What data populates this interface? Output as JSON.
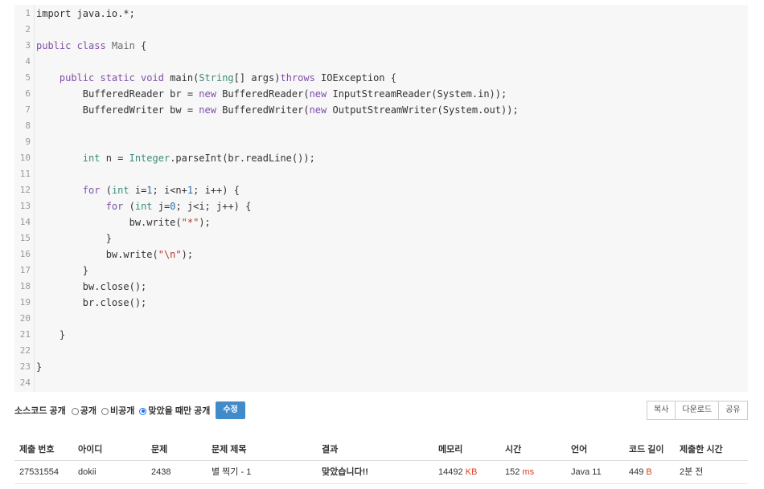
{
  "code": {
    "line_numbers": [
      "1",
      "2",
      "3",
      "4",
      "5",
      "6",
      "7",
      "8",
      "9",
      "10",
      "11",
      "12",
      "13",
      "14",
      "15",
      "16",
      "17",
      "18",
      "19",
      "20",
      "21",
      "22",
      "23",
      "24"
    ],
    "lines": [
      [
        {
          "t": "import java.io.*;",
          "c": ""
        }
      ],
      [],
      [
        {
          "t": "public class ",
          "c": "kw"
        },
        {
          "t": "Main",
          "c": "cn"
        },
        {
          "t": " {",
          "c": ""
        }
      ],
      [],
      [
        {
          "t": "    ",
          "c": ""
        },
        {
          "t": "public static void ",
          "c": "kw"
        },
        {
          "t": "main(",
          "c": ""
        },
        {
          "t": "String",
          "c": "ty"
        },
        {
          "t": "[] args)",
          "c": ""
        },
        {
          "t": "throws ",
          "c": "kw"
        },
        {
          "t": "IOException {",
          "c": ""
        }
      ],
      [
        {
          "t": "        BufferedReader br = ",
          "c": ""
        },
        {
          "t": "new ",
          "c": "kw"
        },
        {
          "t": "BufferedReader(",
          "c": ""
        },
        {
          "t": "new ",
          "c": "kw"
        },
        {
          "t": "InputStreamReader(System.in));",
          "c": ""
        }
      ],
      [
        {
          "t": "        BufferedWriter bw = ",
          "c": ""
        },
        {
          "t": "new ",
          "c": "kw"
        },
        {
          "t": "BufferedWriter(",
          "c": ""
        },
        {
          "t": "new ",
          "c": "kw"
        },
        {
          "t": "OutputStreamWriter(System.out));",
          "c": ""
        }
      ],
      [],
      [],
      [
        {
          "t": "        ",
          "c": ""
        },
        {
          "t": "int ",
          "c": "ty"
        },
        {
          "t": "n = ",
          "c": ""
        },
        {
          "t": "Integer",
          "c": "ty"
        },
        {
          "t": ".parseInt(br.readLine());",
          "c": ""
        }
      ],
      [],
      [
        {
          "t": "        ",
          "c": ""
        },
        {
          "t": "for ",
          "c": "kw"
        },
        {
          "t": "(",
          "c": ""
        },
        {
          "t": "int ",
          "c": "ty"
        },
        {
          "t": "i=",
          "c": ""
        },
        {
          "t": "1",
          "c": "nu"
        },
        {
          "t": "; i<n+",
          "c": ""
        },
        {
          "t": "1",
          "c": "nu"
        },
        {
          "t": "; i++) {",
          "c": ""
        }
      ],
      [
        {
          "t": "            ",
          "c": ""
        },
        {
          "t": "for ",
          "c": "kw"
        },
        {
          "t": "(",
          "c": ""
        },
        {
          "t": "int ",
          "c": "ty"
        },
        {
          "t": "j=",
          "c": ""
        },
        {
          "t": "0",
          "c": "nu"
        },
        {
          "t": "; j<i; j++) {",
          "c": ""
        }
      ],
      [
        {
          "t": "                bw.write(",
          "c": ""
        },
        {
          "t": "\"*\"",
          "c": "st"
        },
        {
          "t": ");",
          "c": ""
        }
      ],
      [
        {
          "t": "            }",
          "c": ""
        }
      ],
      [
        {
          "t": "            bw.write(",
          "c": ""
        },
        {
          "t": "\"\\n\"",
          "c": "st"
        },
        {
          "t": ");",
          "c": ""
        }
      ],
      [
        {
          "t": "        }",
          "c": ""
        }
      ],
      [
        {
          "t": "        bw.close();",
          "c": ""
        }
      ],
      [
        {
          "t": "        br.close();",
          "c": ""
        }
      ],
      [],
      [
        {
          "t": "    }",
          "c": ""
        }
      ],
      [],
      [
        {
          "t": "}",
          "c": ""
        }
      ],
      []
    ]
  },
  "visibility": {
    "label": "소스코드 공개",
    "options": [
      {
        "label": "공개",
        "selected": false
      },
      {
        "label": "비공개",
        "selected": false
      },
      {
        "label": "맞았을 때만 공개",
        "selected": true
      }
    ],
    "edit_button": "수정"
  },
  "actions": {
    "copy": "복사",
    "download": "다운로드",
    "share": "공유"
  },
  "table": {
    "headers": [
      "제출 번호",
      "아이디",
      "문제",
      "문제 제목",
      "결과",
      "메모리",
      "시간",
      "언어",
      "코드 길이",
      "제출한 시간"
    ],
    "row": {
      "submission_id": "27531554",
      "user_id": "dokii",
      "problem_id": "2438",
      "problem_title": "별 찍기 - 1",
      "result": "맞았습니다!!",
      "memory": "14492",
      "memory_unit": "KB",
      "time": "152",
      "time_unit": "ms",
      "language": "Java 11",
      "code_length": "449",
      "code_length_unit": "B",
      "submitted_at": "2분 전"
    }
  },
  "colors": {
    "accent": "#428bca",
    "result_ok": "#009874",
    "unit_red": "#dd4124"
  }
}
